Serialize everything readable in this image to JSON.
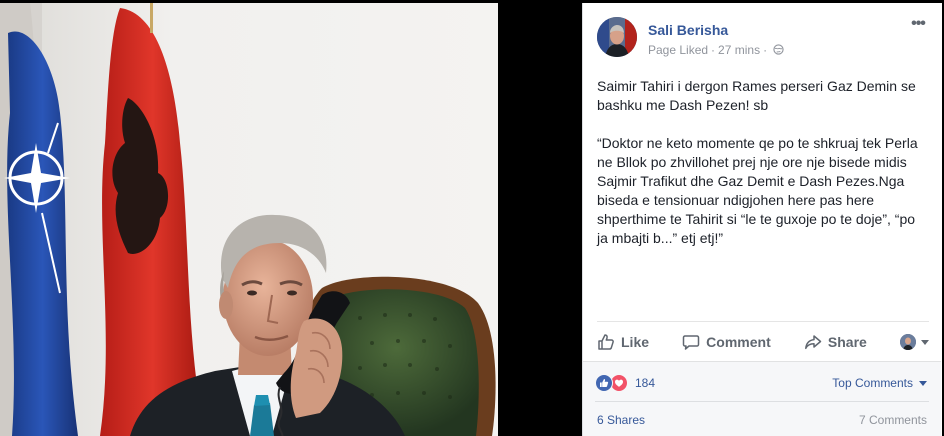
{
  "post": {
    "author": "Sali Berisha",
    "meta_status": "Page Liked",
    "meta_separator": "·",
    "time": "27 mins",
    "paragraphs": [
      "Saimir Tahiri i dergon Rames perseri Gaz Demin se bashku me Dash Pezen! sb",
      "“Doktor ne keto momente qe po te shkruaj tek Perla ne Bllok po zhvillohet prej nje ore nje bisede midis Sajmir Trafikut dhe Gaz Demit e Dash Pezes.Nga biseda e tensionuar ndigjohen here pas here shperthime te Tahirit si “le te guxoje po te doje”, “po ja mbajti b...” etj etj!”"
    ],
    "more_label": "•••"
  },
  "actions": {
    "like": "Like",
    "comment": "Comment",
    "share": "Share"
  },
  "summary": {
    "reaction_count": "184",
    "top_comments": "Top Comments",
    "shares": "6 Shares",
    "comments": "7 Comments"
  },
  "colors": {
    "link": "#365899",
    "meta": "#90949c",
    "action": "#606770",
    "like_reaction": "#4267b2",
    "love_reaction": "#f25268"
  },
  "icons": {
    "globe": "globe-icon",
    "like": "thumbs-up-icon",
    "comment": "speech-bubble-icon",
    "share": "share-arrow-icon",
    "more": "ellipsis-icon"
  }
}
